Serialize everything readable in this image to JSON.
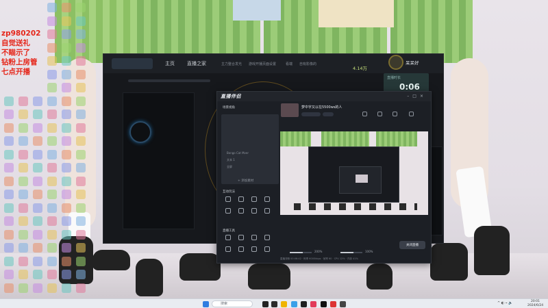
{
  "overlay": {
    "lines": [
      "zp980202",
      "自觉送礼",
      "不瞄示了",
      "钻粉上房管",
      "七点开播"
    ]
  },
  "main_app": {
    "tabs": [
      "主页",
      "直播之家"
    ],
    "sub_tabs": [
      "主力整合发光",
      "游戏开播页面设置",
      "看端",
      "自有影像的"
    ],
    "user_name": "呆呆好",
    "coins": "4.14万",
    "timer_label": "直播时长",
    "timer": "0:06"
  },
  "helper": {
    "title": "直播伴侣",
    "scene_label": "场景视角",
    "scene_items": [
      "Bongo Cat Mver",
      "文本 1",
      "全屏"
    ],
    "add_source": "+ 添加素材",
    "interact_label": "互动玩法",
    "tools_label": "直播工具",
    "room_title": "梦中字又以在5500ws的人",
    "live_button": "关闭直播",
    "zoom_left": "200%",
    "zoom_right": "100%",
    "status_text": "直播流畅 00:06:42 · 码率 6000kbps · 帧率 60 · CPU 12% · 内存 41%"
  },
  "taskbar": {
    "search_placeholder": "搜索",
    "time": "20:01",
    "date": "2024/6/24"
  }
}
